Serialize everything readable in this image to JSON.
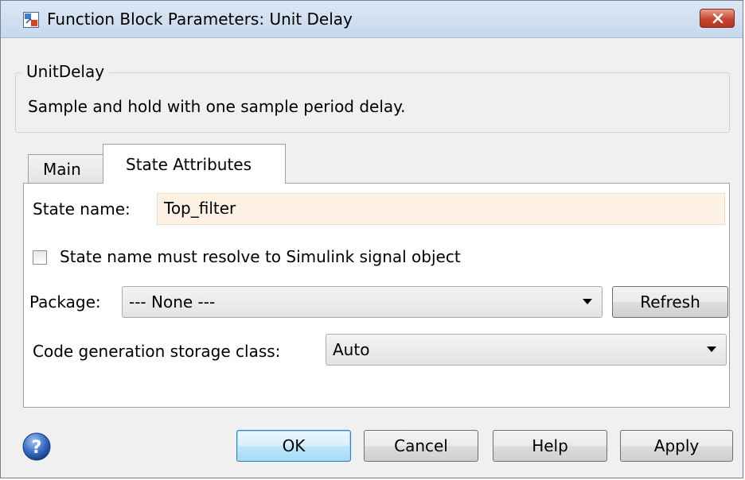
{
  "window": {
    "title": "Function Block Parameters: Unit Delay"
  },
  "group": {
    "legend": "UnitDelay",
    "description": "Sample and hold with one sample period delay."
  },
  "tabs": [
    {
      "label": "Main",
      "active": false
    },
    {
      "label": "State Attributes",
      "active": true
    }
  ],
  "state_attributes": {
    "state_name_label": "State name:",
    "state_name_value": "Top_filter",
    "resolve_checkbox_label": "State name must resolve to Simulink signal object",
    "resolve_checked": false,
    "package_label": "Package:",
    "package_value": "--- None ---",
    "refresh_label": "Refresh",
    "storage_class_label": "Code generation storage class:",
    "storage_class_value": "Auto"
  },
  "buttons": {
    "ok": "OK",
    "cancel": "Cancel",
    "help": "Help",
    "apply": "Apply"
  },
  "icons": {
    "app": "simulink-block-icon",
    "close": "close-icon",
    "help": "help-icon"
  },
  "colors": {
    "state_name_field_bg": "#fdf1e4",
    "close_button": "#c64530",
    "default_button": "#bee6fd"
  }
}
